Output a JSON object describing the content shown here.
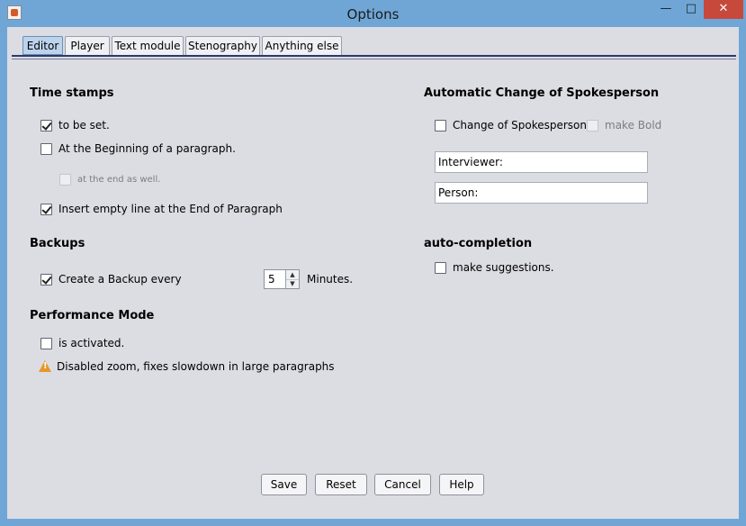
{
  "window": {
    "title": "Options"
  },
  "tabs": [
    "Editor",
    "Player",
    "Text module",
    "Stenography",
    "Anything else"
  ],
  "time_stamps": {
    "heading": "Time stamps",
    "to_be_set": "to be set.",
    "beginning_paragraph": "At the Beginning of a paragraph.",
    "end_as_well": "at the end as well.",
    "insert_empty_line": "Insert empty line at the End of Paragraph"
  },
  "backups": {
    "heading": "Backups",
    "create_backup": "Create a Backup every",
    "minutes_value": "5",
    "minutes_label": "Minutes."
  },
  "performance": {
    "heading": "Performance Mode",
    "is_activated": "is activated.",
    "warning": "Disabled zoom, fixes slowdown in large paragraphs"
  },
  "spokesperson": {
    "heading": "Automatic Change of Spokesperson",
    "change_label": "Change of Spokesperson",
    "make_bold": "make Bold",
    "interviewer": "Interviewer:",
    "person": "Person:"
  },
  "autocompletion": {
    "heading": "auto-completion",
    "make_suggestions": "make suggestions."
  },
  "buttons": {
    "save": "Save",
    "reset": "Reset",
    "cancel": "Cancel",
    "help": "Help"
  },
  "colors": {
    "frame": "#6fa6d6",
    "panel": "#dcdce3",
    "close": "#c7493b",
    "tab_active": "#bcd3ec"
  },
  "icons": {
    "app": "java-app-icon",
    "warning": "warning-icon"
  }
}
